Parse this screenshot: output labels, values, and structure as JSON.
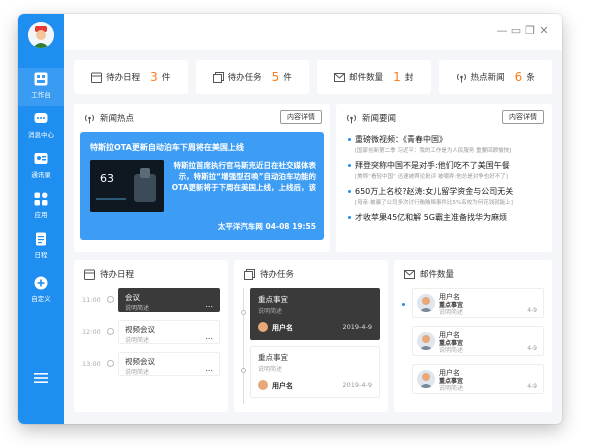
{
  "sidebar": {
    "items": [
      {
        "label": "工作台",
        "icon": "workbench-icon"
      },
      {
        "label": "消息中心",
        "icon": "message-icon"
      },
      {
        "label": "通讯录",
        "icon": "contacts-icon"
      },
      {
        "label": "应用",
        "icon": "apps-icon"
      },
      {
        "label": "日程",
        "icon": "schedule-icon"
      },
      {
        "label": "自定义",
        "icon": "add-custom-icon"
      }
    ]
  },
  "window": {
    "minimize": "—",
    "restore": "▭",
    "maximize": "❐",
    "close": "✕"
  },
  "stats": [
    {
      "label": "待办日程",
      "count": "3",
      "unit": "件"
    },
    {
      "label": "待办任务",
      "count": "5",
      "unit": "件"
    },
    {
      "label": "邮件数量",
      "count": "1",
      "unit": "封"
    },
    {
      "label": "热点新闻",
      "count": "6",
      "unit": "条"
    }
  ],
  "hot": {
    "title": "新闻热点",
    "button": "内容详情",
    "card_title": "特斯拉OTA更新自动泊车下周将在美国上线",
    "card_body": "特斯拉首席执行官马斯克近日在社交媒体表示，特斯拉“增强型召唤”自动泊车功能的OTA更新将于下周在美国上线，上线后，该",
    "source": "太平洋汽车网 04-08 19:55",
    "image_speed": "63"
  },
  "news": {
    "title": "新闻要闻",
    "button": "内容详情",
    "items": [
      {
        "title": "重磅微视频：《青春中国》",
        "sub": "[国家创新第二季 习近平：我的工作是为人民服务 重要回顾愉快]"
      },
      {
        "title": "拜登突称中国不是对手:他们吃不了美国午餐",
        "sub": "[美称“看轻中国” 迅速被舆论批评 被嘲弄:他总是对争也好不了]"
      },
      {
        "title": "650万上名校?赵涛:女儿留学资金与公司无关",
        "sub": "[母亲:被骗了公司多次讨行贿贿赂事件比5%名校为何花钱就能上]"
      },
      {
        "title": "才收苹果45亿和解 5G霸主准备找华为麻烦",
        "sub": ""
      }
    ]
  },
  "schedule": {
    "title": "待办日程",
    "items": [
      {
        "time": "11:00",
        "name": "会议",
        "desc": "说明简述"
      },
      {
        "time": "12:00",
        "name": "视频会议",
        "desc": "说明简述"
      },
      {
        "time": "13:00",
        "name": "视频会议",
        "desc": "说明简述"
      }
    ],
    "more": "..."
  },
  "tasks": {
    "title": "待办任务",
    "items": [
      {
        "name": "重点事宜",
        "desc": "说明简述",
        "user": "用户名",
        "date": "2019-4-9"
      },
      {
        "name": "重点事宜",
        "desc": "说明简述",
        "user": "用户名",
        "date": "2019-4-9"
      }
    ]
  },
  "mail": {
    "title": "邮件数量",
    "items": [
      {
        "name": "用户名",
        "subject": "重点事宜",
        "desc": "说明简述",
        "date": "4-9"
      },
      {
        "name": "用户名",
        "subject": "重点事宜",
        "desc": "说明简述",
        "date": "4-9"
      },
      {
        "name": "用户名",
        "subject": "重点事宜",
        "desc": "说明简述",
        "date": "4-9"
      }
    ]
  },
  "colors": {
    "accent": "#1f8ef1",
    "count": "#ff7a1a",
    "dark_card": "#3a3a3a",
    "hot_card": "#3d9cf4"
  }
}
